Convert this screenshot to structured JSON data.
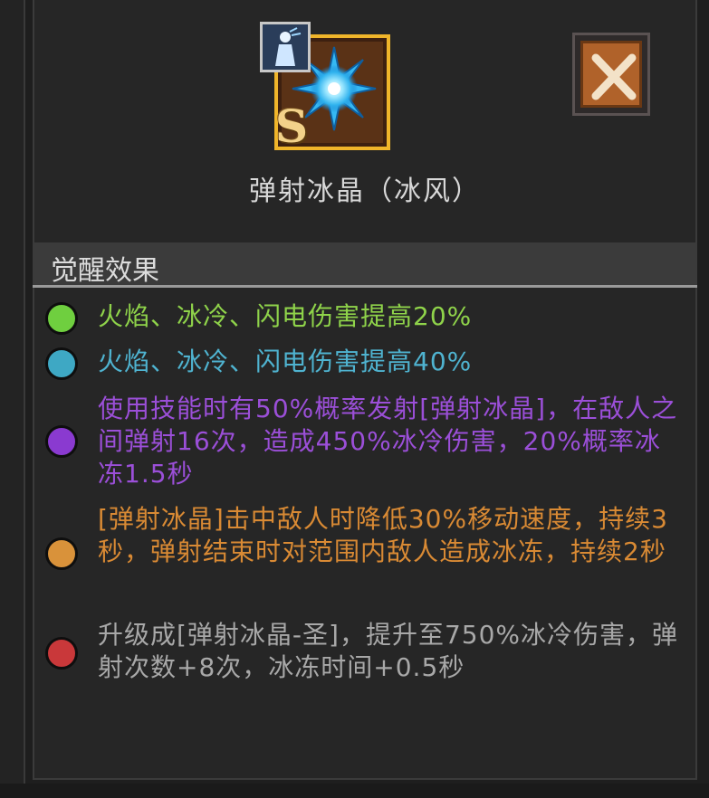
{
  "skill": {
    "name": "弹射冰晶（冰风）",
    "rank": "S",
    "icon": "ice-crystal-icon"
  },
  "section": {
    "title": "觉醒效果"
  },
  "effects": [
    {
      "color": "#6fcf3f",
      "text": "火焰、冰冷、闪电伤害提高20%",
      "text_color": "#8fd34a"
    },
    {
      "color": "#3ea8c4",
      "text": "火焰、冰冷、闪电伤害提高40%",
      "text_color": "#4fb3d0"
    },
    {
      "color": "#8a3ad0",
      "text": "使用技能时有50%概率发射[弹射冰晶]，在敌人之间弹射16次，造成450%冰冷伤害，20%概率冰冻1.5秒",
      "text_color": "#9b4fd8"
    },
    {
      "color": "#d9923a",
      "text": "[弹射冰晶]击中敌人时降低30%移动速度，持续3秒，弹射结束时对范围内敌人造成冰冻，持续2秒",
      "text_color": "#d98a34"
    },
    {
      "color": "#c9383a",
      "text": "升级成[弹射冰晶-圣]，提升至750%冰冷伤害，弹射次数+8次，冰冻时间+0.5秒",
      "text_color": "#a8a8a8"
    }
  ]
}
